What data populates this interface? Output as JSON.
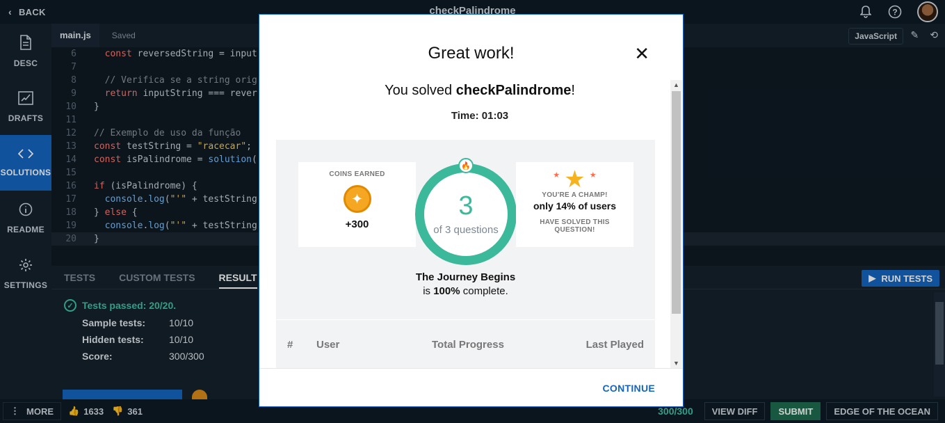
{
  "topbar": {
    "back_label": "BACK",
    "title": "checkPalindrome"
  },
  "sidebar": {
    "items": [
      {
        "label": "DESC",
        "icon": "document-icon"
      },
      {
        "label": "DRAFTS",
        "icon": "drafts-icon"
      },
      {
        "label": "SOLUTIONS",
        "icon": "code-icon",
        "active": true
      },
      {
        "label": "README",
        "icon": "info-icon"
      },
      {
        "label": "SETTINGS",
        "icon": "gear-icon"
      }
    ]
  },
  "editor": {
    "tab_name": "main.js",
    "saved_label": "Saved",
    "language": "JavaScript",
    "lines": [
      {
        "n": "6",
        "text": "  const reversedString = input"
      },
      {
        "n": "7",
        "text": ""
      },
      {
        "n": "8",
        "text": "  // Verifica se a string orig"
      },
      {
        "n": "9",
        "text": "  return inputString === rever"
      },
      {
        "n": "10",
        "text": "}"
      },
      {
        "n": "11",
        "text": ""
      },
      {
        "n": "12",
        "text": "// Exemplo de uso da função"
      },
      {
        "n": "13",
        "text": "const testString = \"racecar\";"
      },
      {
        "n": "14",
        "text": "const isPalindrome = solution("
      },
      {
        "n": "15",
        "text": ""
      },
      {
        "n": "16",
        "text": "if (isPalindrome) {"
      },
      {
        "n": "17",
        "text": "  console.log(\"'\" + testString"
      },
      {
        "n": "18",
        "text": "} else {"
      },
      {
        "n": "19",
        "text": "  console.log(\"'\" + testString"
      },
      {
        "n": "20",
        "text": "}"
      }
    ]
  },
  "panel": {
    "tabs": [
      "TESTS",
      "CUSTOM TESTS",
      "RESULT"
    ],
    "run_label": "RUN TESTS",
    "passed": "Tests passed: 20/20.",
    "rows": [
      {
        "k": "Sample tests:",
        "v": "10/10"
      },
      {
        "k": "Hidden tests:",
        "v": "10/10"
      },
      {
        "k": "Score:",
        "v": "300/300"
      }
    ]
  },
  "footer": {
    "more_label": "MORE",
    "likes": "1633",
    "dislikes": "361",
    "score": "300/300",
    "view_diff": "VIEW DIFF",
    "submit": "SUBMIT",
    "next": "EDGE OF THE OCEAN"
  },
  "modal": {
    "title": "Great work!",
    "solved_prefix": "You solved ",
    "solved_task": "checkPalindrome",
    "solved_suffix": "!",
    "time": "Time: 01:03",
    "coins_label": "COINS EARNED",
    "coins_value": "+300",
    "questions_done": "3",
    "questions_total": "of 3 questions",
    "champ_top": "YOU'RE A CHAMP!",
    "champ_main": "only 14% of users",
    "champ_bottom": "HAVE SOLVED THIS QUESTION!",
    "journey_name": "The Journey Begins",
    "journey_is": "is ",
    "journey_pct": "100%",
    "journey_suffix": " complete.",
    "table_headers": {
      "hash": "#",
      "user": "User",
      "progress": "Total Progress",
      "last": "Last Played"
    },
    "continue_label": "CONTINUE"
  }
}
